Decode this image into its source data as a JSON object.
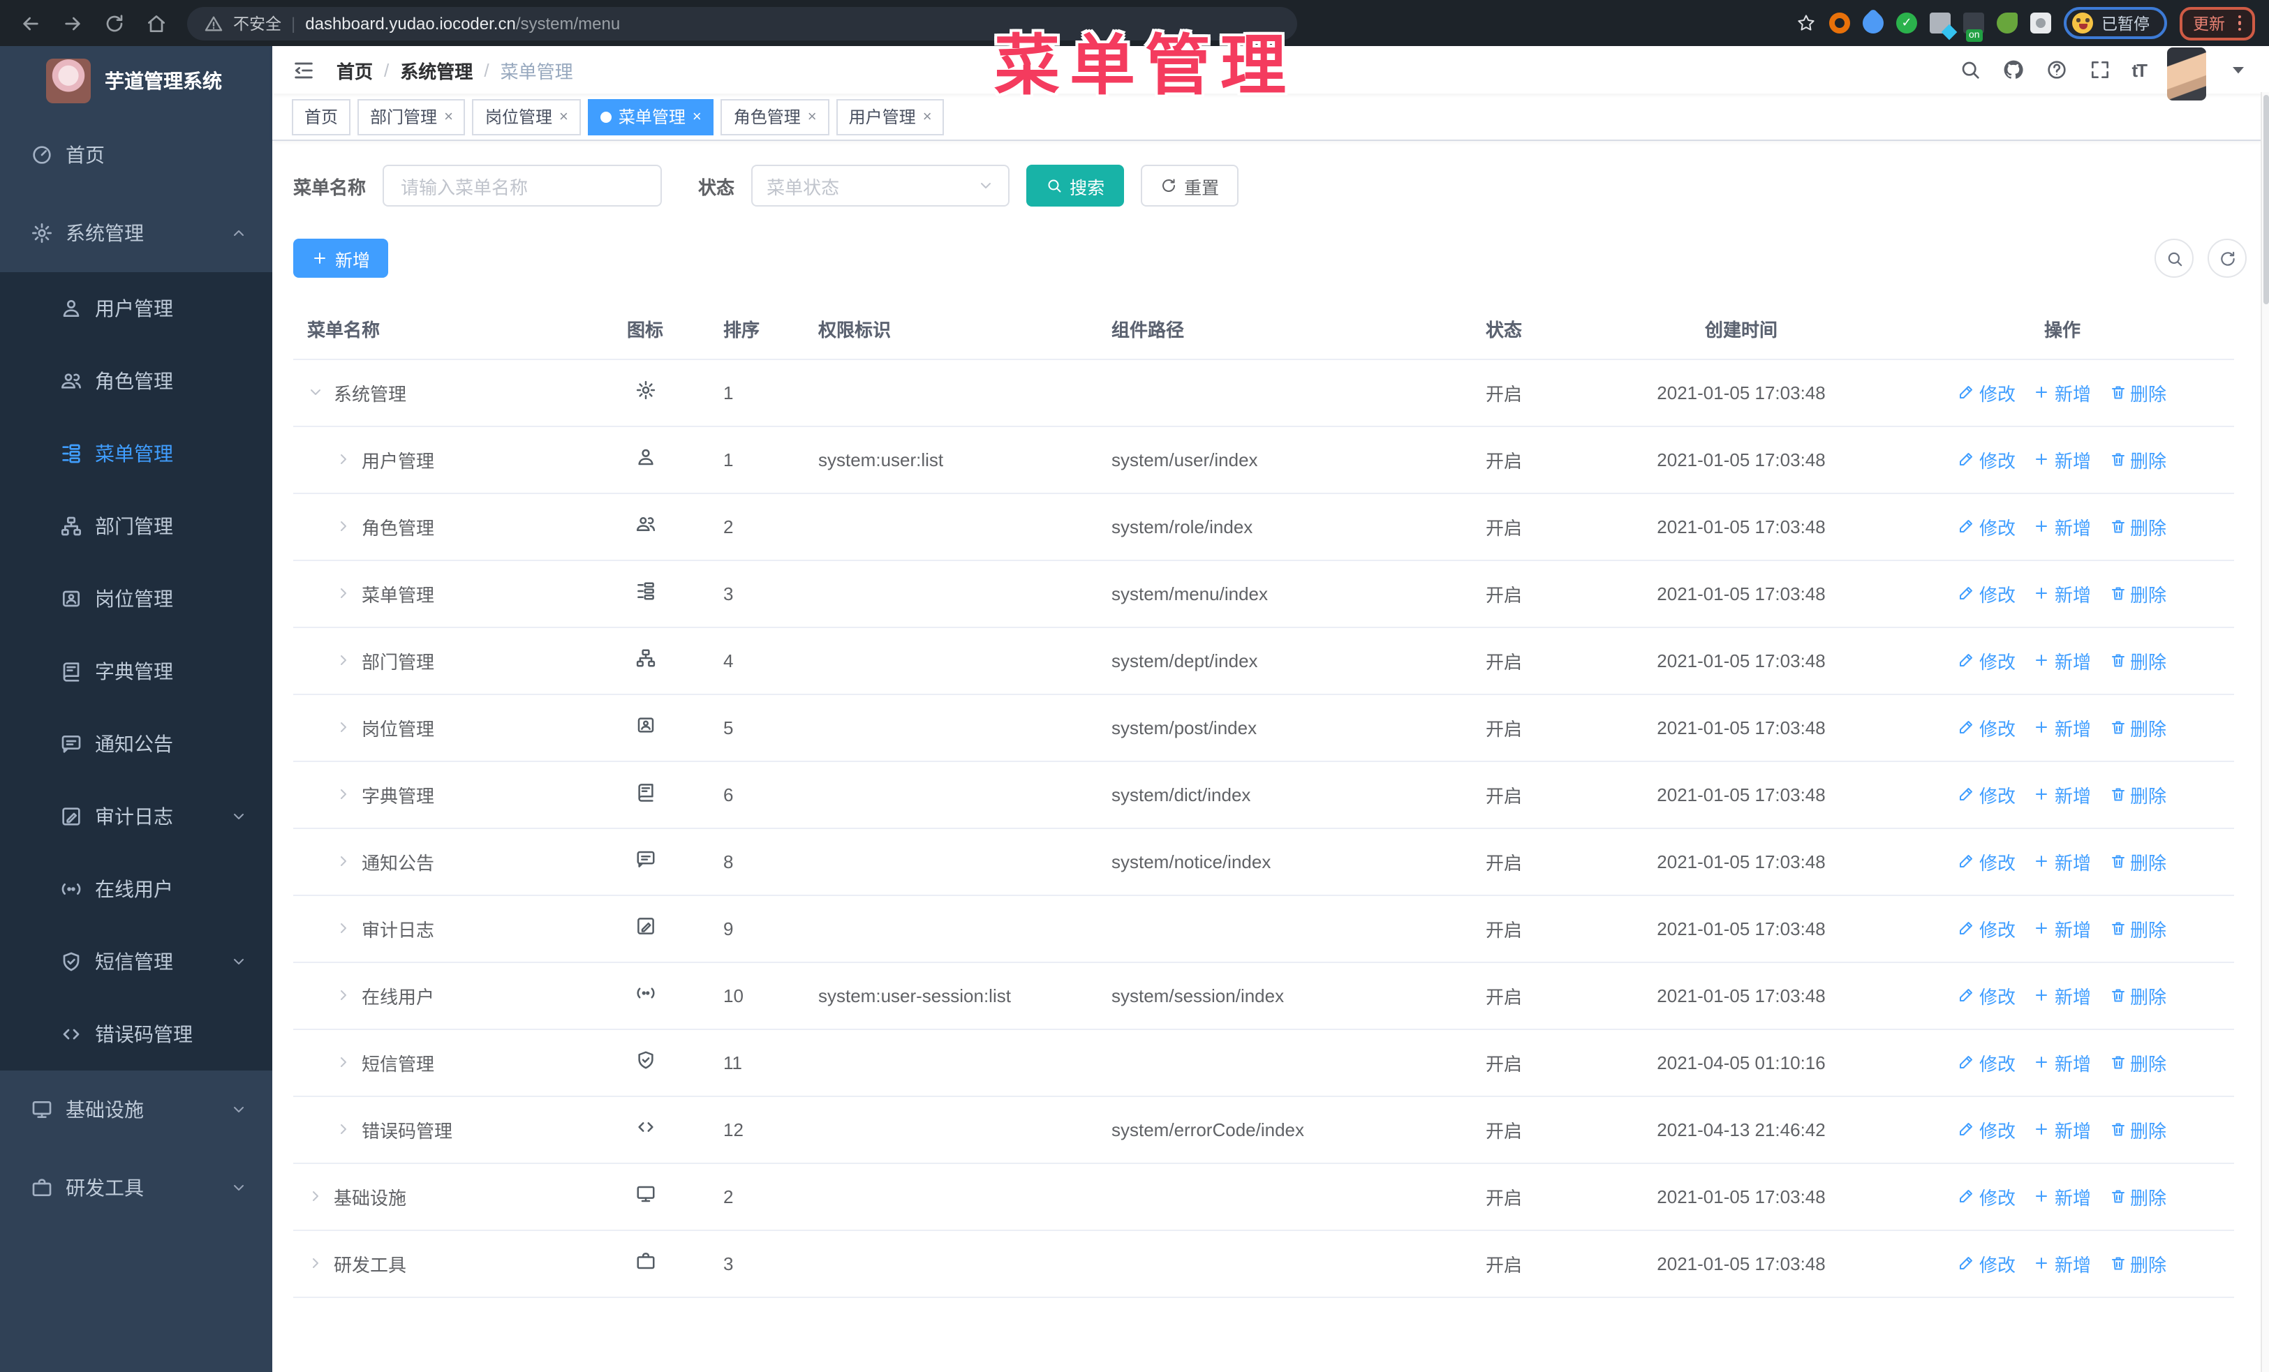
{
  "colors": {
    "accent": "#409eff",
    "search_button": "#18b3a7",
    "annotation": "#f43b5e",
    "sidebar_bg": "#304156",
    "submenu_bg": "#1f2d3d",
    "active_tab": "#409eff"
  },
  "annotation": {
    "text": "菜单管理"
  },
  "browser": {
    "security_label": "不安全",
    "url_host": "dashboard.yudao.iocoder.cn",
    "url_path": "/system/menu",
    "paused_label": "已暂停",
    "update_label": "更新",
    "extension_on_badge": "on"
  },
  "sidebar": {
    "logo_title": "芋道管理系统",
    "items": [
      {
        "label": "首页",
        "icon": "dashboard",
        "type": "top"
      },
      {
        "label": "系统管理",
        "icon": "gear",
        "type": "top",
        "arrow": "up"
      },
      {
        "label": "用户管理",
        "icon": "user",
        "type": "sub"
      },
      {
        "label": "角色管理",
        "icon": "users",
        "type": "sub"
      },
      {
        "label": "菜单管理",
        "icon": "tree-table",
        "type": "sub",
        "active": true
      },
      {
        "label": "部门管理",
        "icon": "tree",
        "type": "sub"
      },
      {
        "label": "岗位管理",
        "icon": "badge",
        "type": "sub"
      },
      {
        "label": "字典管理",
        "icon": "book",
        "type": "sub"
      },
      {
        "label": "通知公告",
        "icon": "message",
        "type": "sub"
      },
      {
        "label": "审计日志",
        "icon": "log",
        "type": "sub",
        "arrow": "down"
      },
      {
        "label": "在线用户",
        "icon": "online",
        "type": "sub"
      },
      {
        "label": "短信管理",
        "icon": "shield",
        "type": "sub",
        "arrow": "down"
      },
      {
        "label": "错误码管理",
        "icon": "code",
        "type": "sub"
      },
      {
        "label": "基础设施",
        "icon": "monitor",
        "type": "top",
        "arrow": "down"
      },
      {
        "label": "研发工具",
        "icon": "briefcase",
        "type": "top",
        "arrow": "down"
      }
    ]
  },
  "header": {
    "breadcrumb": [
      "首页",
      "系统管理",
      "菜单管理"
    ],
    "font_icon_text": "tT"
  },
  "tabs": [
    {
      "label": "首页",
      "closable": false,
      "active": false
    },
    {
      "label": "部门管理",
      "closable": true,
      "active": false
    },
    {
      "label": "岗位管理",
      "closable": true,
      "active": false
    },
    {
      "label": "菜单管理",
      "closable": true,
      "active": true
    },
    {
      "label": "角色管理",
      "closable": true,
      "active": false
    },
    {
      "label": "用户管理",
      "closable": true,
      "active": false
    }
  ],
  "filters": {
    "name_label": "菜单名称",
    "name_placeholder": "请输入菜单名称",
    "status_label": "状态",
    "status_placeholder": "菜单状态",
    "search_label": "搜索",
    "reset_label": "重置"
  },
  "toolbar": {
    "add_label": "新增"
  },
  "table": {
    "columns": [
      "菜单名称",
      "图标",
      "排序",
      "权限标识",
      "组件路径",
      "状态",
      "创建时间",
      "操作"
    ],
    "action_labels": [
      {
        "label": "修改",
        "icon": "edit"
      },
      {
        "label": "新增",
        "icon": "plus"
      },
      {
        "label": "删除",
        "icon": "trash"
      }
    ],
    "rows": [
      {
        "name": "系统管理",
        "icon": "gear",
        "level": 0,
        "expanded": true,
        "sort": "1",
        "perm": "",
        "path": "",
        "status": "开启",
        "time": "2021-01-05 17:03:48"
      },
      {
        "name": "用户管理",
        "icon": "user",
        "level": 1,
        "expanded": false,
        "sort": "1",
        "perm": "system:user:list",
        "path": "system/user/index",
        "status": "开启",
        "time": "2021-01-05 17:03:48"
      },
      {
        "name": "角色管理",
        "icon": "users",
        "level": 1,
        "expanded": false,
        "sort": "2",
        "perm": "",
        "path": "system/role/index",
        "status": "开启",
        "time": "2021-01-05 17:03:48"
      },
      {
        "name": "菜单管理",
        "icon": "tree-table",
        "level": 1,
        "expanded": false,
        "sort": "3",
        "perm": "",
        "path": "system/menu/index",
        "status": "开启",
        "time": "2021-01-05 17:03:48"
      },
      {
        "name": "部门管理",
        "icon": "tree",
        "level": 1,
        "expanded": false,
        "sort": "4",
        "perm": "",
        "path": "system/dept/index",
        "status": "开启",
        "time": "2021-01-05 17:03:48"
      },
      {
        "name": "岗位管理",
        "icon": "badge",
        "level": 1,
        "expanded": false,
        "sort": "5",
        "perm": "",
        "path": "system/post/index",
        "status": "开启",
        "time": "2021-01-05 17:03:48"
      },
      {
        "name": "字典管理",
        "icon": "book",
        "level": 1,
        "expanded": false,
        "sort": "6",
        "perm": "",
        "path": "system/dict/index",
        "status": "开启",
        "time": "2021-01-05 17:03:48"
      },
      {
        "name": "通知公告",
        "icon": "message",
        "level": 1,
        "expanded": false,
        "sort": "8",
        "perm": "",
        "path": "system/notice/index",
        "status": "开启",
        "time": "2021-01-05 17:03:48"
      },
      {
        "name": "审计日志",
        "icon": "log",
        "level": 1,
        "expanded": false,
        "sort": "9",
        "perm": "",
        "path": "",
        "status": "开启",
        "time": "2021-01-05 17:03:48"
      },
      {
        "name": "在线用户",
        "icon": "online",
        "level": 1,
        "expanded": false,
        "sort": "10",
        "perm": "system:user-session:list",
        "path": "system/session/index",
        "status": "开启",
        "time": "2021-01-05 17:03:48"
      },
      {
        "name": "短信管理",
        "icon": "shield",
        "level": 1,
        "expanded": false,
        "sort": "11",
        "perm": "",
        "path": "",
        "status": "开启",
        "time": "2021-04-05 01:10:16"
      },
      {
        "name": "错误码管理",
        "icon": "code",
        "level": 1,
        "expanded": false,
        "sort": "12",
        "perm": "",
        "path": "system/errorCode/index",
        "status": "开启",
        "time": "2021-04-13 21:46:42"
      },
      {
        "name": "基础设施",
        "icon": "monitor",
        "level": 0,
        "expanded": false,
        "sort": "2",
        "perm": "",
        "path": "",
        "status": "开启",
        "time": "2021-01-05 17:03:48"
      },
      {
        "name": "研发工具",
        "icon": "briefcase",
        "level": 0,
        "expanded": false,
        "sort": "3",
        "perm": "",
        "path": "",
        "status": "开启",
        "time": "2021-01-05 17:03:48"
      }
    ]
  }
}
